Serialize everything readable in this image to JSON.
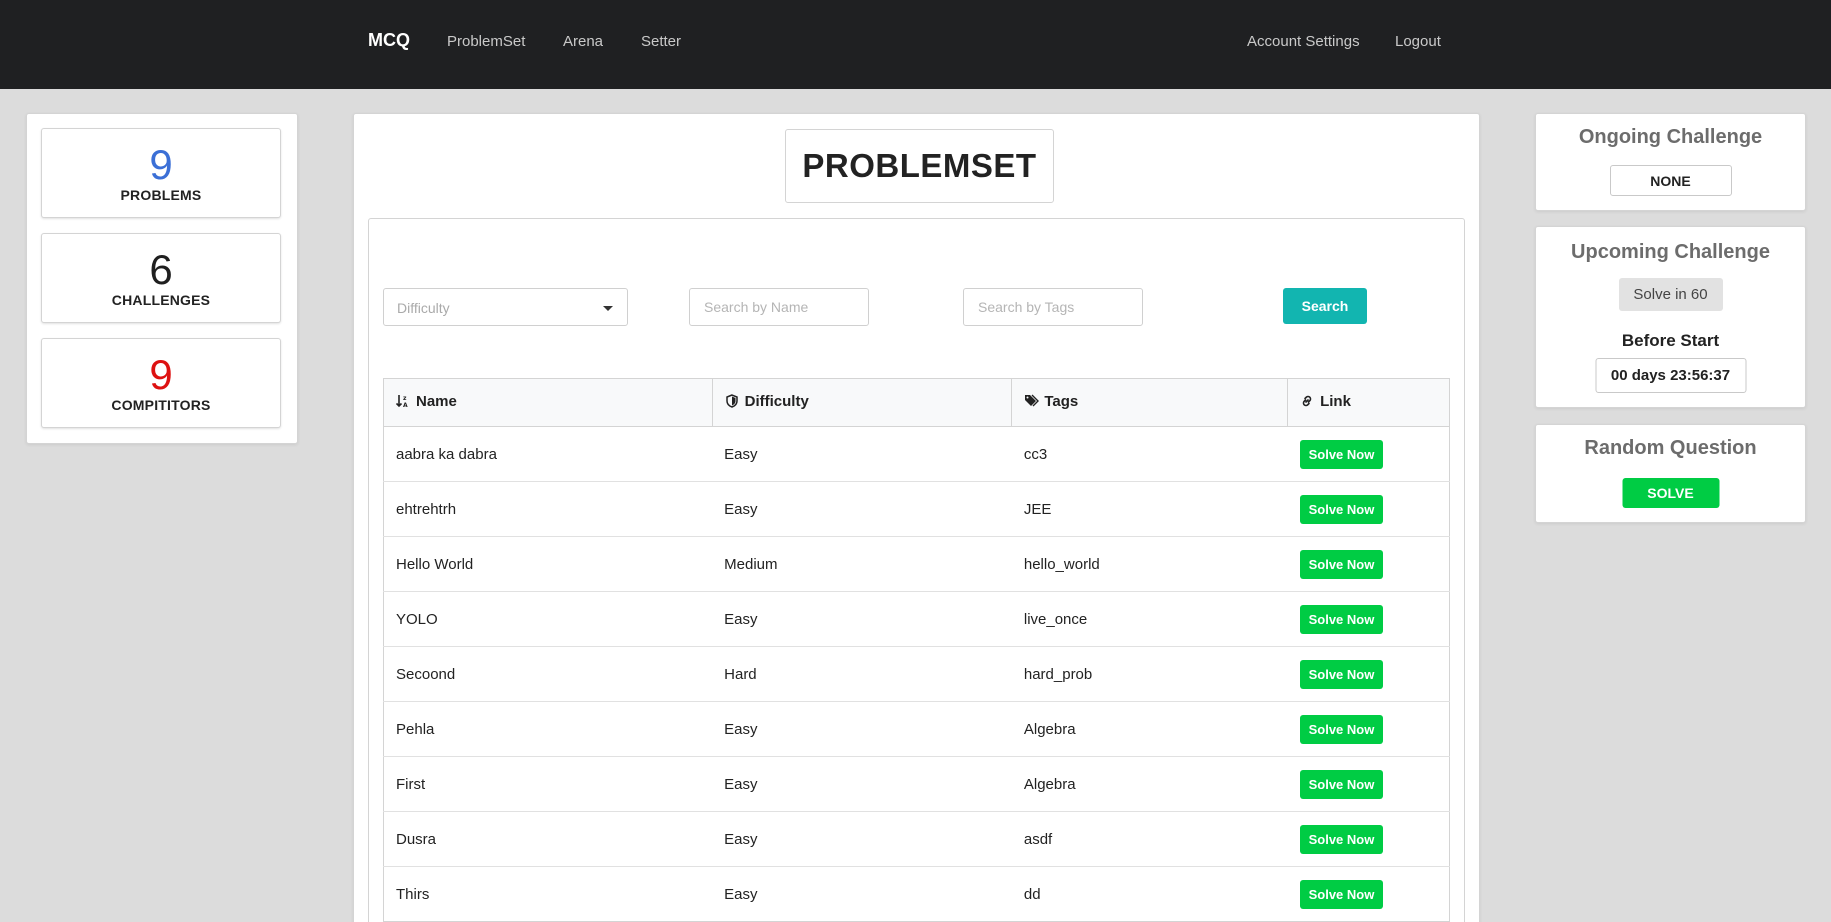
{
  "nav": {
    "brand": "MCQ",
    "links": [
      "ProblemSet",
      "Arena",
      "Setter"
    ],
    "right_links": [
      "Account Settings",
      "Logout"
    ]
  },
  "stats": [
    {
      "value": "9",
      "label": "PROBLEMS",
      "color": "#3b6fd6"
    },
    {
      "value": "6",
      "label": "CHALLENGES",
      "color": "#1f1f1f"
    },
    {
      "value": "9",
      "label": "COMPITITORS",
      "color": "#dd1111"
    }
  ],
  "main": {
    "title": "PROBLEMSET",
    "filters": {
      "difficulty_placeholder": "Difficulty",
      "name_placeholder": "Search by Name",
      "tags_placeholder": "Search by Tags",
      "search_label": "Search"
    },
    "table": {
      "headers": [
        "Name",
        "Difficulty",
        "Tags",
        "Link"
      ],
      "header_icons": [
        "sort-alpha-icon",
        "shield-icon",
        "tags-icon",
        "link-icon"
      ],
      "button_label": "Solve Now",
      "rows": [
        {
          "name": "aabra ka dabra",
          "difficulty": "Easy",
          "tags": "cc3"
        },
        {
          "name": "ehtrehtrh",
          "difficulty": "Easy",
          "tags": "JEE"
        },
        {
          "name": "Hello World",
          "difficulty": "Medium",
          "tags": "hello_world"
        },
        {
          "name": "YOLO",
          "difficulty": "Easy",
          "tags": "live_once"
        },
        {
          "name": "Secoond",
          "difficulty": "Hard",
          "tags": "hard_prob"
        },
        {
          "name": "Pehla",
          "difficulty": "Easy",
          "tags": "Algebra"
        },
        {
          "name": "First",
          "difficulty": "Easy",
          "tags": "Algebra"
        },
        {
          "name": "Dusra",
          "difficulty": "Easy",
          "tags": "asdf"
        },
        {
          "name": "Thirs",
          "difficulty": "Easy",
          "tags": "dd"
        }
      ]
    }
  },
  "sidebar": {
    "ongoing": {
      "title": "Ongoing Challenge",
      "value": "NONE"
    },
    "upcoming": {
      "title": "Upcoming Challenge",
      "name": "Solve in 60",
      "before_label": "Before Start",
      "countdown": "00 days 23:56:37"
    },
    "random": {
      "title": "Random Question",
      "button": "SOLVE"
    }
  }
}
